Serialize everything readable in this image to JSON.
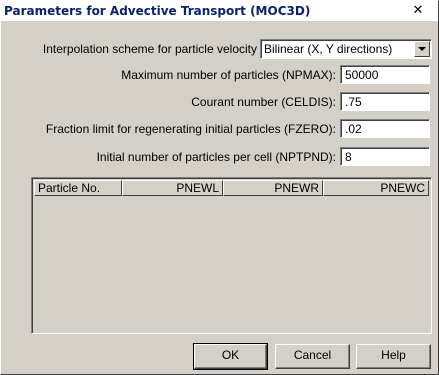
{
  "window": {
    "title": "Parameters for Advective Transport (MOC3D)",
    "close_glyph": "✕"
  },
  "form": {
    "interpolation_label": "Interpolation scheme for particle velocity",
    "interpolation_value": "Bilinear (X, Y directions)",
    "npmax_label": "Maximum number of particles (NPMAX):",
    "npmax_value": "50000",
    "celdis_label": "Courant number (CELDIS):",
    "celdis_value": ".75",
    "fzero_label": "Fraction limit for regenerating initial particles (FZERO):",
    "fzero_value": ".02",
    "nptpnd_label": "Initial number of particles per cell (NPTPND):",
    "nptpnd_value": "8"
  },
  "table": {
    "columns": [
      "Particle No.",
      "PNEWL",
      "PNEWR",
      "PNEWC"
    ],
    "rows": []
  },
  "buttons": {
    "ok": "OK",
    "cancel": "Cancel",
    "help": "Help"
  }
}
